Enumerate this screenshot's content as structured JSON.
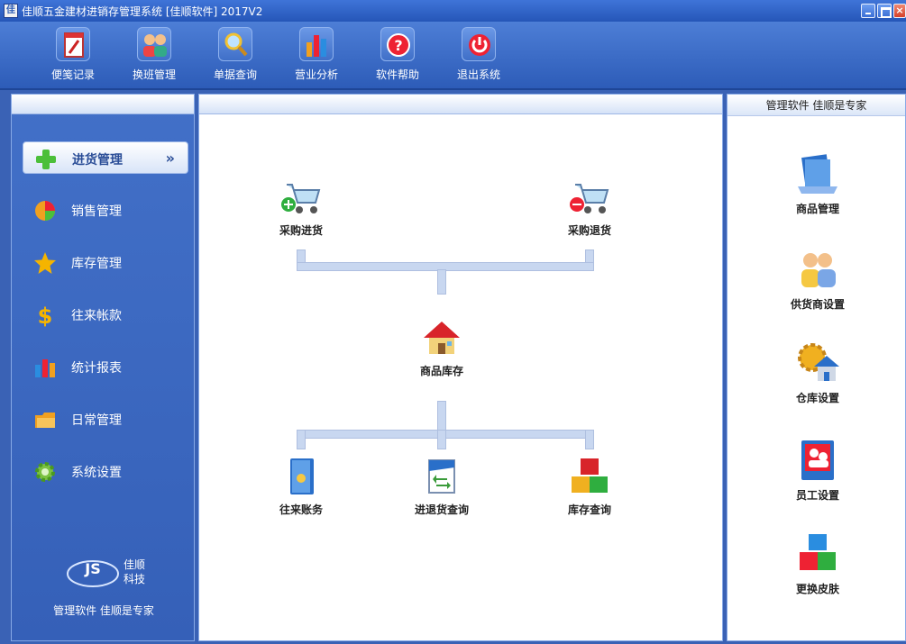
{
  "window": {
    "app_icon": "佳",
    "title": "佳顺五金建材进销存管理系统 [佳顺软件] 2017V2",
    "close_glyph": "×"
  },
  "toolbar": {
    "items": [
      {
        "label": "便笺记录",
        "icon": "notepad-icon"
      },
      {
        "label": "换班管理",
        "icon": "shift-people-icon"
      },
      {
        "label": "单据查询",
        "icon": "magnifier-icon"
      },
      {
        "label": "营业分析",
        "icon": "bar-chart-icon"
      },
      {
        "label": "软件帮助",
        "icon": "help-icon"
      },
      {
        "label": "退出系统",
        "icon": "power-icon"
      }
    ]
  },
  "sidebar": {
    "items": [
      {
        "label": "进货管理",
        "icon": "plus-icon",
        "active": true,
        "chevron": "»"
      },
      {
        "label": "销售管理",
        "icon": "pie-icon"
      },
      {
        "label": "库存管理",
        "icon": "star-icon"
      },
      {
        "label": "往来帐款",
        "icon": "dollar-icon"
      },
      {
        "label": "统计报表",
        "icon": "bar-chart-icon"
      },
      {
        "label": "日常管理",
        "icon": "folder-icon"
      },
      {
        "label": "系统设置",
        "icon": "gear-icon"
      }
    ],
    "logo": {
      "mark": "JS",
      "name_line1": "佳顺",
      "name_line2": "科技"
    },
    "tagline": "管理软件 佳顺是专家"
  },
  "main": {
    "flow": {
      "purchase_in": "采购进货",
      "purchase_return": "采购退货",
      "inventory": "商品库存",
      "accounts": "往来账务",
      "returns_query": "进退货查询",
      "stock_query": "库存查询"
    }
  },
  "right": {
    "header": "管理软件 佳顺是专家",
    "items": [
      {
        "label": "商品管理",
        "icon": "product-stack-icon"
      },
      {
        "label": "供货商设置",
        "icon": "suppliers-icon"
      },
      {
        "label": "仓库设置",
        "icon": "warehouse-gear-icon"
      },
      {
        "label": "员工设置",
        "icon": "employee-icon"
      },
      {
        "label": "更换皮肤",
        "icon": "cubes-icon"
      }
    ]
  }
}
